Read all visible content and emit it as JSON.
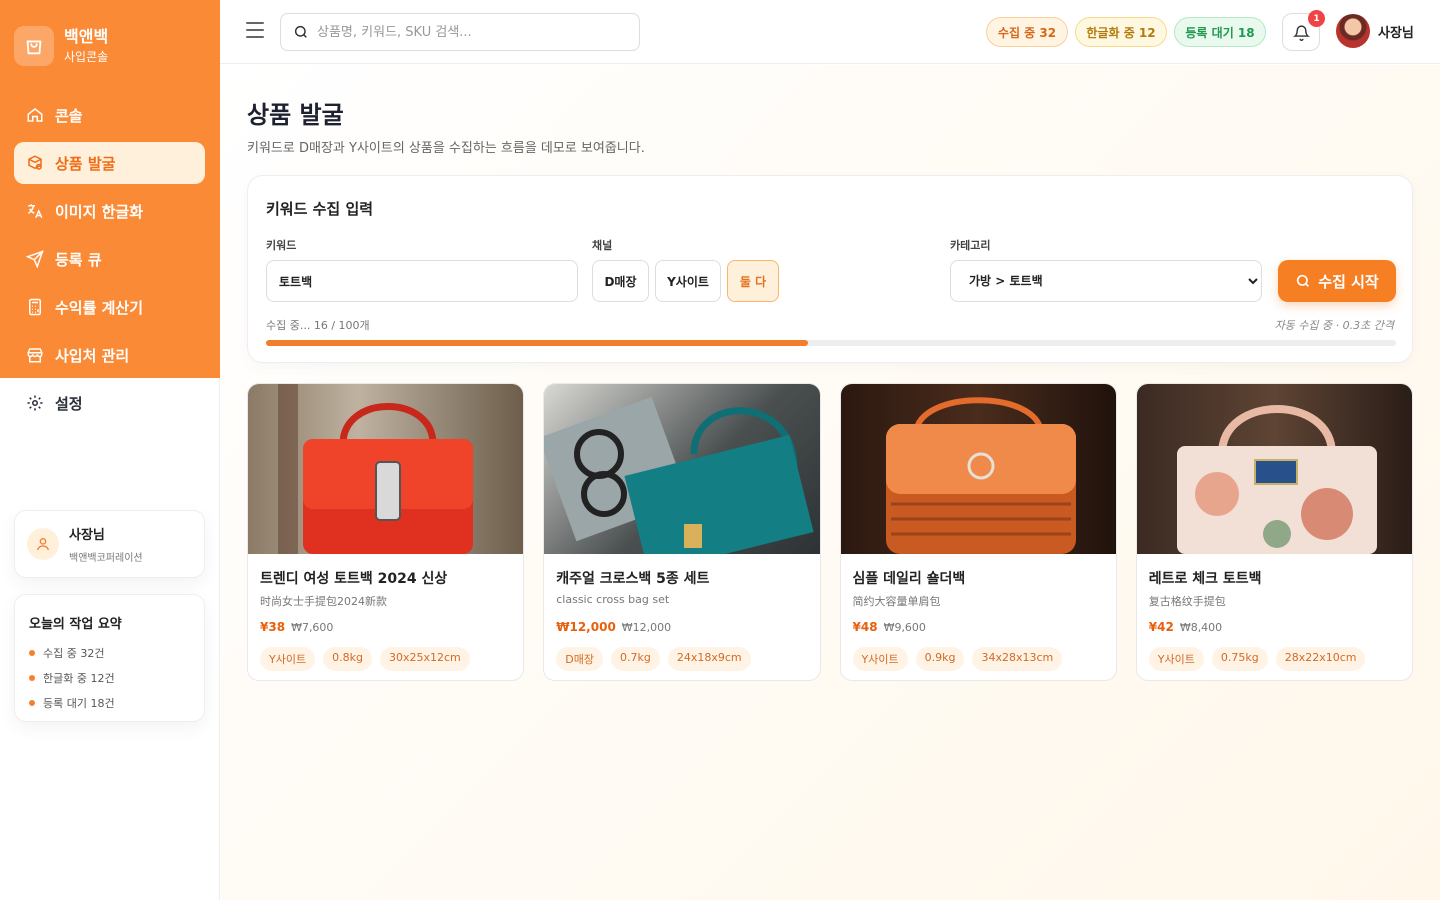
{
  "brand": {
    "title": "백앤백",
    "subtitle": "사입콘솔"
  },
  "sidebar": {
    "items": [
      {
        "label": "콘솔"
      },
      {
        "label": "상품 발굴"
      },
      {
        "label": "이미지 한글화"
      },
      {
        "label": "등록 큐"
      },
      {
        "label": "수익률 계산기"
      },
      {
        "label": "사입처 관리"
      },
      {
        "label": "설정"
      }
    ],
    "active_index": 1
  },
  "user_card": {
    "name": "사장님",
    "company": "백앤백코퍼레이션"
  },
  "summary": {
    "title": "오늘의 작업 요약",
    "items": [
      "수집 중 32건",
      "한글화 중 12건",
      "등록 대기 18건"
    ]
  },
  "header": {
    "search_placeholder": "상품명, 키워드, SKU 검색...",
    "pills": {
      "collecting": "수집 중 32",
      "translating": "한글화 중 12",
      "waiting": "등록 대기 18"
    },
    "notification_count": "1",
    "user_name": "사장님"
  },
  "colors": {
    "accent": "#fb8a36",
    "button": "#f67f23",
    "price": "#e85f0c"
  },
  "page": {
    "title": "상품 발굴",
    "description": "키워드로 D매장과 Y사이트의 상품을 수집하는 흐름을 데모로 보여줍니다."
  },
  "panel": {
    "title": "키워드 수집 입력",
    "keyword_label": "키워드",
    "keyword_value": "토트백",
    "channel_label": "채널",
    "channels": [
      "D매장",
      "Y사이트",
      "둘 다"
    ],
    "active_channel": "둘 다",
    "category_label": "카테고리",
    "category_value": "가방 > 토트백",
    "start_button": "수집 시작",
    "progress_text": "수집 중... 16 / 100개",
    "progress_note": "자동 수집 중 · 0.3초 간격",
    "progress_fraction": 0.48
  },
  "products": [
    {
      "title": "트렌디 여성 토트백 2024 신상",
      "subtitle": "时尚女士手提包2024新款",
      "price": "¥38",
      "krw": "₩7,600",
      "tags": [
        "Y사이트",
        "0.8kg",
        "30x25x12cm"
      ]
    },
    {
      "title": "캐주얼 크로스백 5종 세트",
      "subtitle": "classic cross bag set",
      "price": "₩12,000",
      "krw": "₩12,000",
      "tags": [
        "D매장",
        "0.7kg",
        "24x18x9cm"
      ]
    },
    {
      "title": "심플 데일리 숄더백",
      "subtitle": "简约大容量单肩包",
      "price": "¥48",
      "krw": "₩9,600",
      "tags": [
        "Y사이트",
        "0.9kg",
        "34x28x13cm"
      ]
    },
    {
      "title": "레트로 체크 토트백",
      "subtitle": "复古格纹手提包",
      "price": "¥42",
      "krw": "₩8,400",
      "tags": [
        "Y사이트",
        "0.75kg",
        "28x22x10cm"
      ]
    }
  ]
}
